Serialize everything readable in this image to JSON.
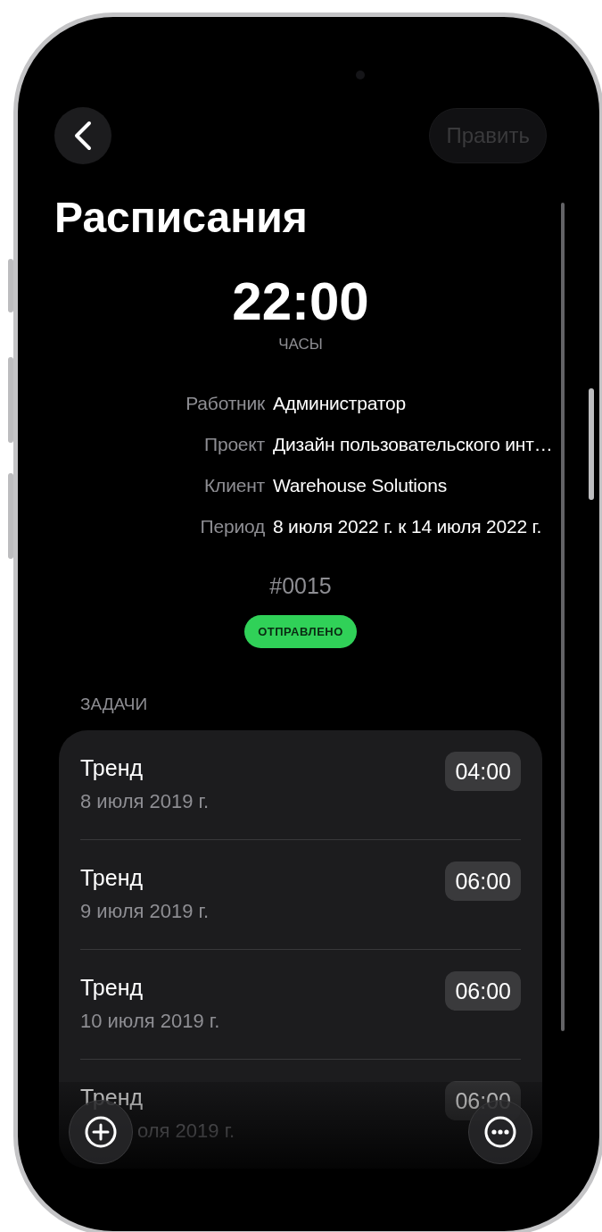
{
  "edit_button": {
    "label": "Править",
    "disabled": true
  },
  "title": "Расписания",
  "total": {
    "value": "22:00",
    "unit": "ЧАСЫ"
  },
  "details": [
    {
      "label": "Работник",
      "value": "Администратор"
    },
    {
      "label": "Проект",
      "value": "Дизайн пользовательского инт…"
    },
    {
      "label": "Клиент",
      "value": "Warehouse Solutions"
    },
    {
      "label": "Период",
      "value": "8 июля 2022 г. к 14 июля 2022 г."
    }
  ],
  "number": "#0015",
  "status": "ОТПРАВЛЕНО",
  "tasks_header": "ЗАДАЧИ",
  "tasks": [
    {
      "kind": "full",
      "title": "Тренд",
      "date": "8 июля 2019 г.",
      "duration": "04:00"
    },
    {
      "kind": "full",
      "title": "Тренд",
      "date": "9 июля 2019 г.",
      "duration": "06:00"
    },
    {
      "kind": "full",
      "title": "Тренд",
      "date": "10 июля 2019 г.",
      "duration": "06:00"
    },
    {
      "kind": "covered",
      "title": "Тренд",
      "date": "оля 2019 г.",
      "duration": "06:00"
    }
  ]
}
